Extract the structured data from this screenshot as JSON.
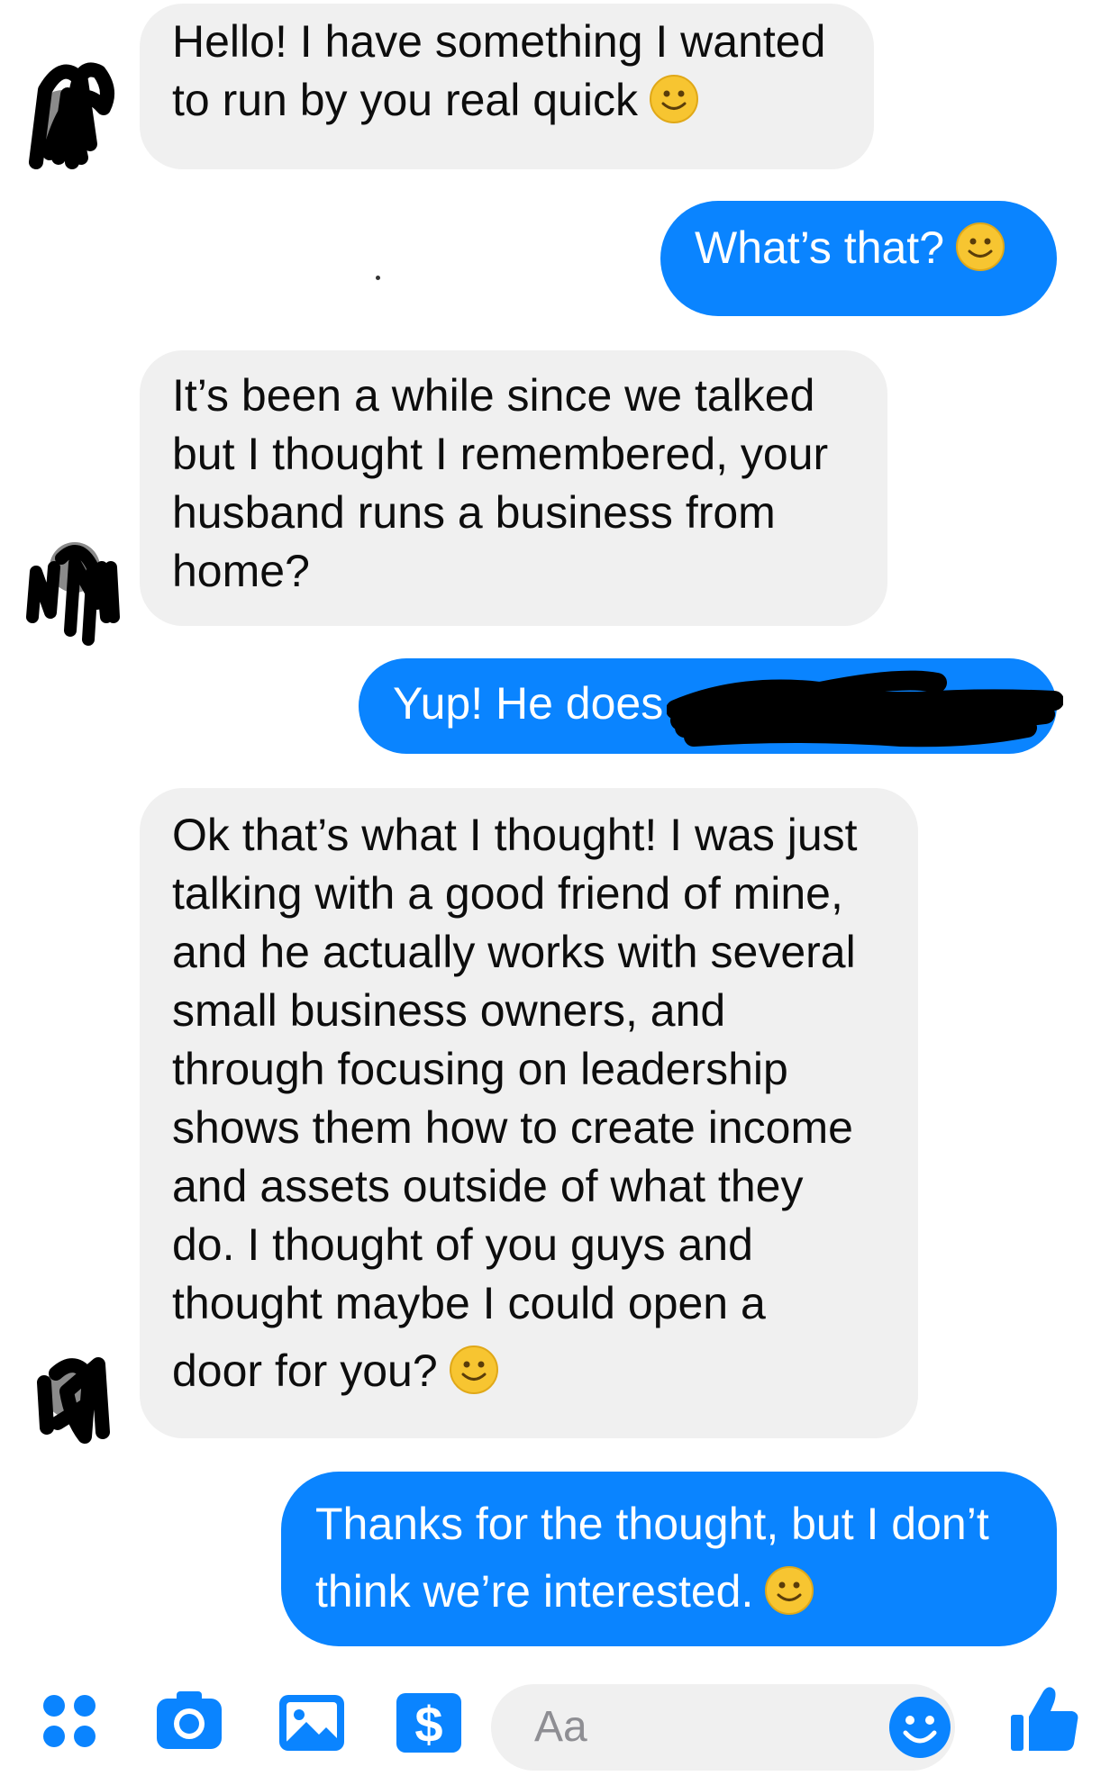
{
  "thread": {
    "messages": [
      {
        "from": "them",
        "lines": [
          "Hello! I have something I wanted",
          "to run by you real quick"
        ],
        "emoji": "smiley"
      },
      {
        "from": "me",
        "lines": [
          "What’s that?"
        ],
        "emoji": "smiley"
      },
      {
        "from": "them",
        "lines": [
          "It’s been a while since we talked",
          "but I thought I remembered, your",
          "husband runs a business from",
          "home?"
        ]
      },
      {
        "from": "me",
        "lines": [
          "Yup! He does"
        ],
        "redacted": true
      },
      {
        "from": "them",
        "lines": [
          "Ok that’s what I thought! I was just",
          "talking with a good friend of mine,",
          "and he actually works with several",
          "small business owners, and",
          "through focusing on leadership",
          "shows them how to create income",
          "and assets outside of what they",
          "do. I thought of you guys and",
          "thought maybe I could open a",
          "door for you?"
        ],
        "emoji": "smiley"
      },
      {
        "from": "me",
        "lines": [
          "Thanks for the thought, but I don’t",
          "think we’re interested."
        ],
        "emoji": "smiley"
      }
    ]
  },
  "composer": {
    "placeholder": "Aa",
    "tools": [
      "more-icon",
      "camera-icon",
      "photo-icon",
      "payment-icon"
    ],
    "right_icons": [
      "emoji-icon",
      "like-icon"
    ]
  },
  "colors": {
    "outgoing": "#0a84ff",
    "incoming": "#f0f0f0",
    "emoji": "#f7c531"
  }
}
